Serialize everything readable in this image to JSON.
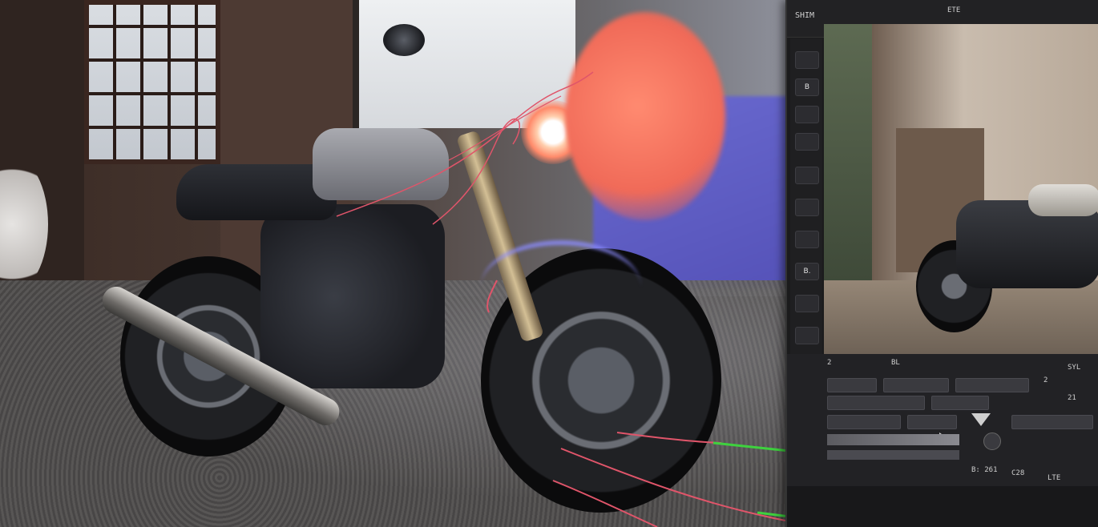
{
  "editor": {
    "title": "SHIM",
    "toolbar_right": "ETE",
    "tools": [
      "",
      "B",
      "",
      "",
      "",
      "",
      "",
      "B.",
      "",
      ""
    ],
    "bottom": {
      "row1_left": "2",
      "row1_mid": "BL",
      "row1_right": "SYL",
      "num_1": "2",
      "num_2": "21",
      "status_left": "B: 261",
      "status_mid": "C28",
      "status_right": "LTE"
    }
  },
  "colors": {
    "accent_orange": "#f06a58",
    "accent_purple": "#5552b8",
    "wire_red": "#e0556a",
    "wire_green": "#3ed13e"
  },
  "icons": [
    "gear-icon",
    "play-icon",
    "triangle-icon"
  ]
}
